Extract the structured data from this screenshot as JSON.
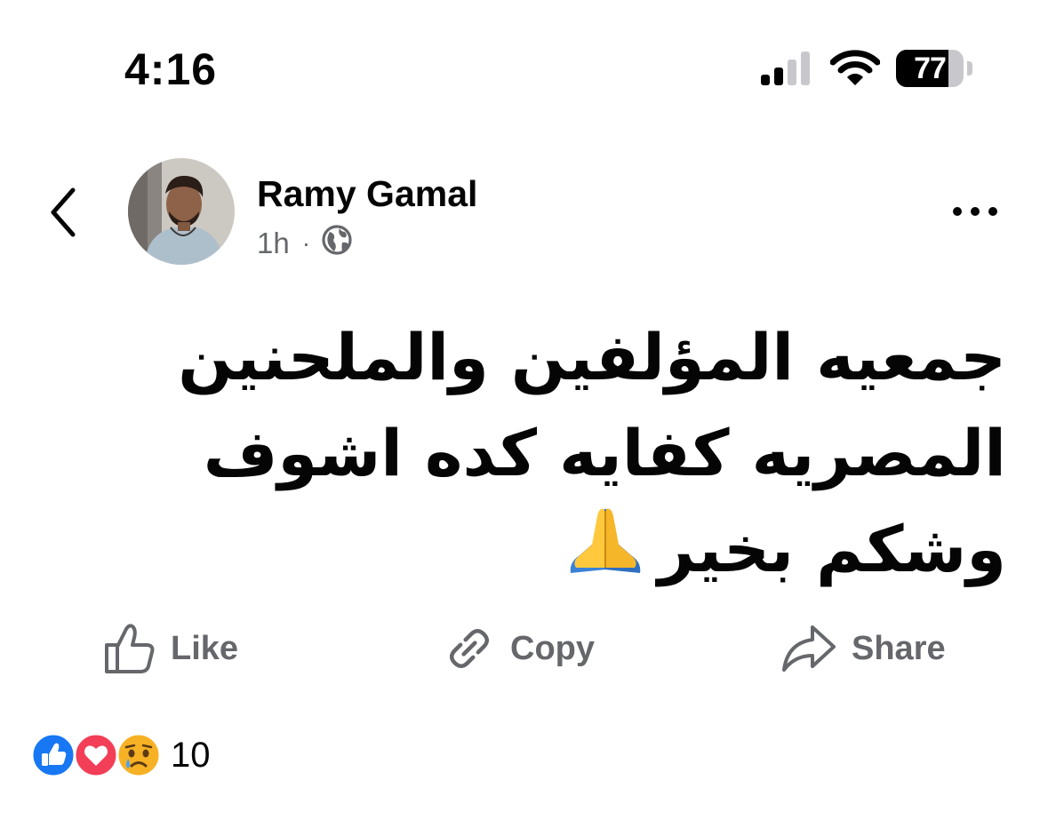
{
  "status_bar": {
    "time": "4:16",
    "battery_level": "77",
    "battery_fraction": 0.77,
    "signal_bars_active": 2,
    "signal_bars_total": 4,
    "icons": [
      "signal-icon",
      "wifi-icon",
      "battery-icon"
    ]
  },
  "post": {
    "author": "Ramy Gamal",
    "time_ago": "1h",
    "separator": "·",
    "audience_icon": "globe-icon",
    "text": "جمعيه المؤلفين والملحنين المصريه كفايه كده اشوف وشكم بخير",
    "trailing_emoji": "folded-hands-emoji"
  },
  "actions": {
    "like": "Like",
    "copy": "Copy",
    "share": "Share"
  },
  "reactions": {
    "types": [
      "like",
      "love",
      "sad"
    ],
    "count": "10"
  },
  "colors": {
    "text": "#050505",
    "secondary_text": "#65676b",
    "facebook_blue": "#1877f2",
    "love_red": "#f33e58",
    "sad_yellow": "#f7b125"
  }
}
